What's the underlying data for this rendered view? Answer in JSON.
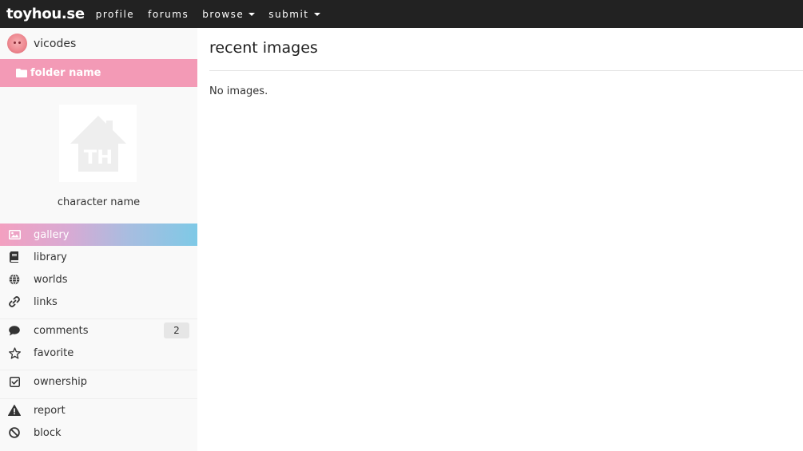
{
  "navbar": {
    "brand": "toyhou.se",
    "items": [
      {
        "label": "profile",
        "dropdown": false
      },
      {
        "label": "forums",
        "dropdown": false
      },
      {
        "label": "browse",
        "dropdown": true
      },
      {
        "label": "submit",
        "dropdown": true
      }
    ]
  },
  "sidebar": {
    "user": {
      "name": "vicodes",
      "avatar_icon": "pig-avatar"
    },
    "folder": {
      "label": "folder name",
      "icon": "folder-icon"
    },
    "character": {
      "name": "character name",
      "thumb_text": "TH"
    },
    "menu": [
      {
        "label": "gallery",
        "icon": "image-icon",
        "active": true
      },
      {
        "label": "library",
        "icon": "book-icon"
      },
      {
        "label": "worlds",
        "icon": "globe-icon"
      },
      {
        "label": "links",
        "icon": "link-icon"
      },
      {
        "label": "comments",
        "icon": "comment-icon",
        "badge": "2"
      },
      {
        "label": "favorite",
        "icon": "star-icon"
      },
      {
        "label": "ownership",
        "icon": "check-square-icon"
      },
      {
        "label": "report",
        "icon": "warning-icon"
      },
      {
        "label": "block",
        "icon": "ban-icon"
      }
    ]
  },
  "main": {
    "title": "recent images",
    "empty_text": "No images."
  },
  "colors": {
    "navbar_bg": "#222222",
    "folder_pink": "#f39ab6",
    "active_gradient_start": "#f3a0c0",
    "active_gradient_end": "#7ec9e6"
  }
}
